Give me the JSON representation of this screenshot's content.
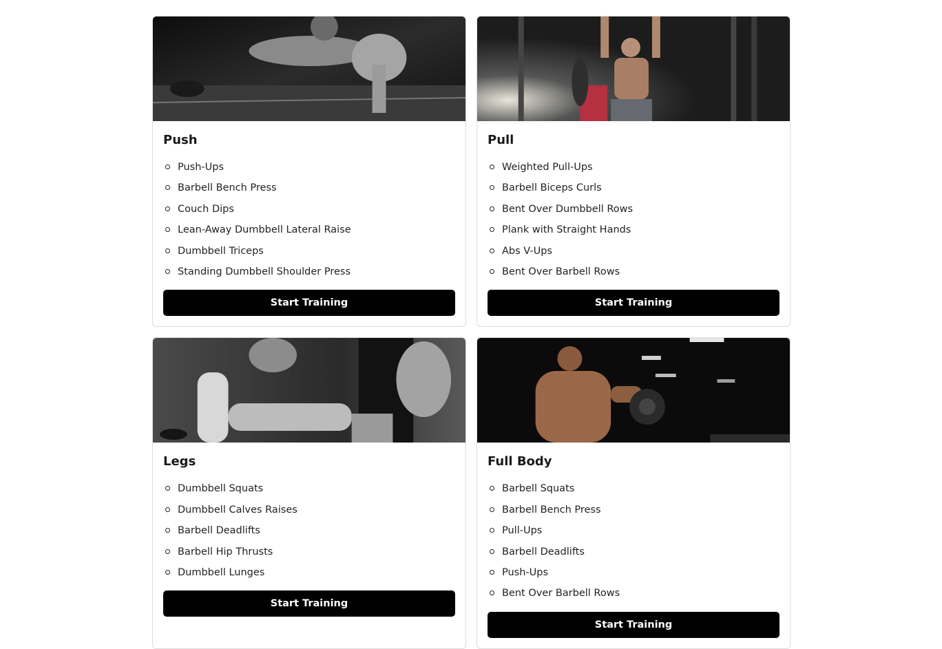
{
  "workouts": [
    {
      "title": "Push",
      "exercises": [
        "Push-Ups",
        "Barbell Bench Press",
        "Couch Dips",
        "Lean-Away Dumbbell Lateral Raise",
        "Dumbbell Triceps",
        "Standing Dumbbell Shoulder Press"
      ],
      "button_label": "Start Training"
    },
    {
      "title": "Pull",
      "exercises": [
        "Weighted Pull-Ups",
        "Barbell Biceps Curls",
        "Bent Over Dumbbell Rows",
        "Plank with Straight Hands",
        "Abs V-Ups",
        "Bent Over Barbell Rows"
      ],
      "button_label": "Start Training"
    },
    {
      "title": "Legs",
      "exercises": [
        "Dumbbell Squats",
        "Dumbbell Calves Raises",
        "Barbell Deadlifts",
        "Barbell Hip Thrusts",
        "Dumbbell Lunges"
      ],
      "button_label": "Start Training"
    },
    {
      "title": "Full Body",
      "exercises": [
        "Barbell Squats",
        "Barbell Bench Press",
        "Pull-Ups",
        "Barbell Deadlifts",
        "Push-Ups",
        "Bent Over Barbell Rows"
      ],
      "button_label": "Start Training"
    }
  ],
  "colors": {
    "button_bg": "#000000",
    "button_text": "#ffffff",
    "card_border": "#dcdcdc"
  }
}
